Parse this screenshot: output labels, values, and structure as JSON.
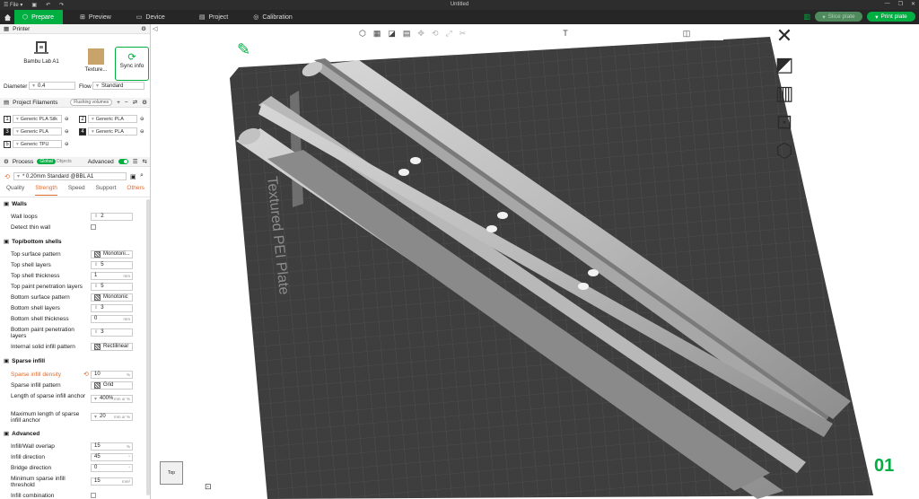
{
  "titlebar": {
    "menu_label": "File",
    "title": "Untitled"
  },
  "nav": {
    "tabs": [
      {
        "label": "Prepare"
      },
      {
        "label": "Preview"
      },
      {
        "label": "Device"
      },
      {
        "label": "Project"
      },
      {
        "label": "Calibration"
      }
    ],
    "slice_label": "Slice plate",
    "print_label": "Print plate"
  },
  "printer": {
    "title": "Printer",
    "name": "Bambu Lab A1",
    "plate": "Texture...",
    "sync_label": "Sync info",
    "diameter_label": "Diameter",
    "diameter_value": "0.4",
    "flow_label": "Flow",
    "flow_value": "Standard"
  },
  "filaments": {
    "title": "Project Filaments",
    "flushing": "Flushing volumes",
    "items": [
      {
        "num": "1",
        "name": "Generic PLA Silk",
        "color": "#ffffff"
      },
      {
        "num": "2",
        "name": "Generic PLA",
        "color": "#ffffff"
      },
      {
        "num": "3",
        "name": "Generic PLA",
        "color": "#222222"
      },
      {
        "num": "4",
        "name": "Generic PLA",
        "color": "#222222"
      },
      {
        "num": "5",
        "name": "Generic TPU",
        "color": "#ffffff"
      }
    ]
  },
  "process": {
    "title": "Process",
    "global": "Global",
    "objects": "Objects",
    "advanced": "Advanced",
    "preset": "* 0.20mm Standard @BBL A1",
    "tabs": [
      "Quality",
      "Strength",
      "Speed",
      "Support",
      "Others"
    ]
  },
  "params": {
    "walls": "Walls",
    "wall_loops": "Wall loops",
    "wall_loops_v": "2",
    "detect_thin": "Detect thin wall",
    "topbottom": "Top/bottom shells",
    "top_pattern": "Top surface pattern",
    "top_pattern_v": "Monotoni...",
    "top_layers": "Top shell layers",
    "top_layers_v": "5",
    "top_thick": "Top shell thickness",
    "top_thick_v": "1",
    "top_paint": "Top paint penetration layers",
    "top_paint_v": "5",
    "bottom_pattern": "Bottom surface pattern",
    "bottom_pattern_v": "Monotonic",
    "bottom_layers": "Bottom shell layers",
    "bottom_layers_v": "3",
    "bottom_thick": "Bottom shell thickness",
    "bottom_thick_v": "0",
    "bottom_paint": "Bottom paint penetration layers",
    "bottom_paint_v": "3",
    "internal_pattern": "Internal solid infill pattern",
    "internal_pattern_v": "Rectilinear",
    "sparse": "Sparse infill",
    "density": "Sparse infill density",
    "density_v": "10",
    "sparse_pattern": "Sparse infill pattern",
    "sparse_pattern_v": "Grid",
    "anchor_len": "Length of sparse infill anchor",
    "anchor_len_v": "400%",
    "anchor_max": "Maximum length of sparse infill anchor",
    "anchor_max_v": "20",
    "advanced": "Advanced",
    "overlap": "Infill/Wall overlap",
    "overlap_v": "15",
    "infill_dir": "Infill direction",
    "infill_dir_v": "45",
    "bridge_dir": "Bridge direction",
    "bridge_dir_v": "0",
    "min_sparse": "Minimum sparse infill threshold",
    "min_sparse_v": "15",
    "infill_comb": "Infill combination"
  },
  "units": {
    "pct": "%",
    "mm": "mm",
    "deg": "°",
    "mm2": "mm²",
    "mmorpct": "mm or %"
  },
  "viewport": {
    "plate_label": "Textured PEI Plate",
    "plate_number": "01",
    "view_cube_label": "Top"
  }
}
